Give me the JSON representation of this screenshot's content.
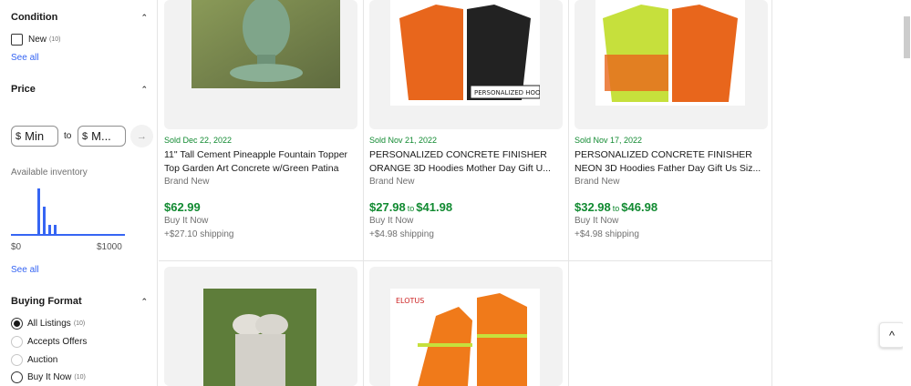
{
  "sidebar": {
    "condition": {
      "title": "Condition",
      "options": [
        {
          "label": "New",
          "count": "(10)"
        }
      ],
      "see_all": "See all"
    },
    "price": {
      "title": "Price",
      "min_placeholder": "Min",
      "max_placeholder": "M...",
      "currency": "$",
      "to": "to"
    },
    "inventory": {
      "label": "Available inventory",
      "min_label": "$0",
      "max_label": "$1000",
      "see_all": "See all"
    },
    "buying_format": {
      "title": "Buying Format",
      "options": [
        {
          "label": "All Listings",
          "count": "(10)",
          "selected": true
        },
        {
          "label": "Accepts Offers",
          "count": "",
          "selected": false
        },
        {
          "label": "Auction",
          "count": "",
          "selected": false
        },
        {
          "label": "Buy It Now",
          "count": "(10)",
          "selected": false
        }
      ]
    }
  },
  "items": [
    {
      "sold": "Sold Dec 22, 2022",
      "title1": "11\" Tall Cement Pineapple Fountain Topper",
      "title2": "Top Garden Art Concrete w/Green Patina",
      "condition": "Brand New",
      "price": "$62.99",
      "price_to": "",
      "price_max": "",
      "format": "Buy It Now",
      "shipping": "+$27.10 shipping",
      "image_color": "#6b8f5c"
    },
    {
      "sold": "Sold Nov 21, 2022",
      "title1": "PERSONALIZED CONCRETE FINISHER",
      "title2": "ORANGE 3D Hoodies Mother Day Gift U...",
      "condition": "Brand New",
      "price": "$27.98",
      "price_to": "to",
      "price_max": "$41.98",
      "format": "Buy It Now",
      "shipping": "+$4.98 shipping",
      "image_color": "#e8661c",
      "image_text": "PERSONALIZED HOODIE"
    },
    {
      "sold": "Sold Nov 17, 2022",
      "title1": "PERSONALIZED CONCRETE FINISHER",
      "title2": "NEON 3D Hoodies Father Day Gift Us Siz...",
      "condition": "Brand New",
      "price": "$32.98",
      "price_to": "to",
      "price_max": "$46.98",
      "format": "Buy It Now",
      "shipping": "+$4.98 shipping",
      "image_color": "#c6e03c"
    },
    {
      "image_color": "#d9d6cf"
    },
    {
      "image_color": "#f07a1a",
      "image_text": "ELOTUS"
    }
  ],
  "scroll_top": "^"
}
